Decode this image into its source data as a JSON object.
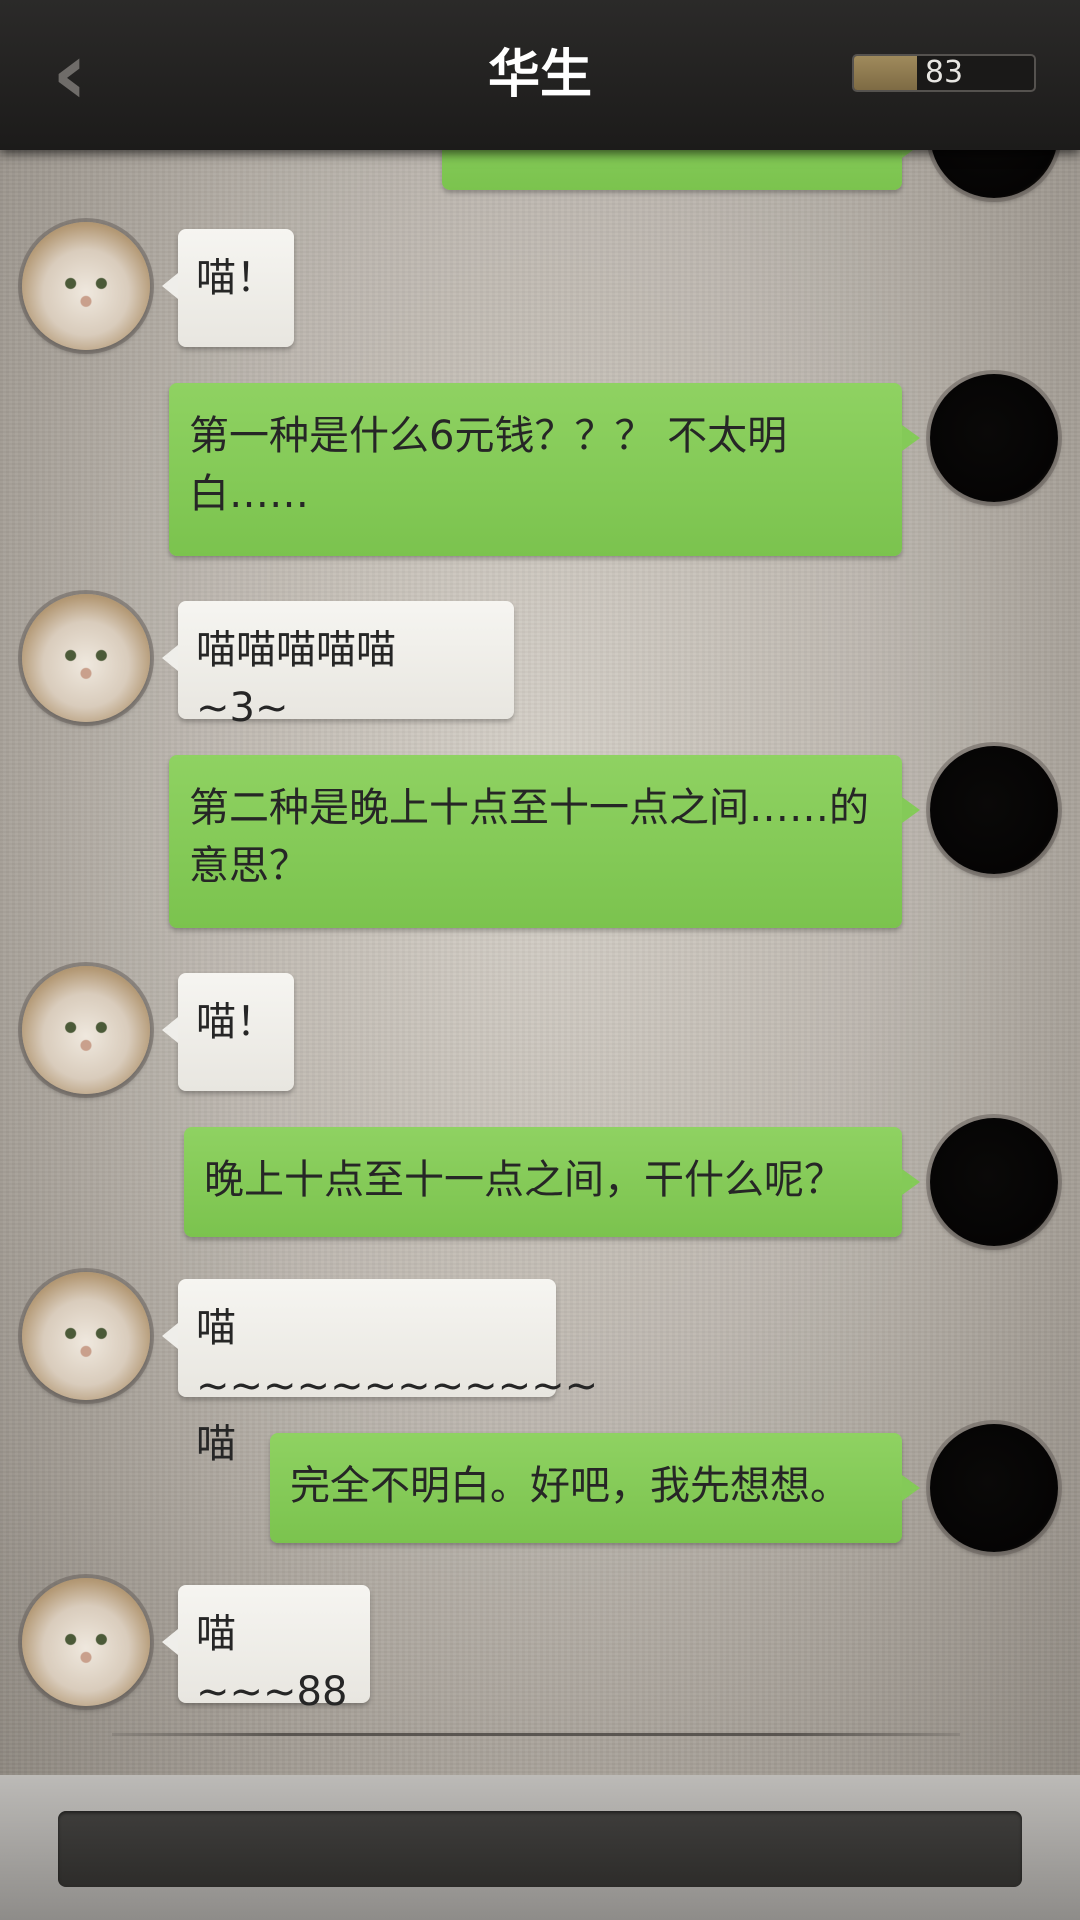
{
  "header": {
    "back_icon": "chevron-left-icon",
    "title": "华生",
    "score_value": 83,
    "score_label": "83",
    "score_fill_fraction": 0.35
  },
  "messages": [
    {
      "side": "out",
      "text": ""
    },
    {
      "side": "in",
      "text": "喵！"
    },
    {
      "side": "out",
      "text": "第一种是什么6元钱？？？ 不太明白……"
    },
    {
      "side": "in",
      "text": "喵喵喵喵喵 ~3~"
    },
    {
      "side": "out",
      "text": "第二种是晚上十点至十一点之间……的意思？"
    },
    {
      "side": "in",
      "text": "喵！"
    },
    {
      "side": "out",
      "text": "晚上十点至十一点之间，干什么呢？"
    },
    {
      "side": "in",
      "text": "喵~~~~~~~~~~~~喵"
    },
    {
      "side": "out",
      "text": "完全不明白。好吧，我先想想。"
    },
    {
      "side": "in",
      "text": "喵~~~88"
    }
  ],
  "input": {
    "placeholder": ""
  },
  "colors": {
    "header_bg": "#1f1e1d",
    "outgoing_bubble": "#84ca58",
    "incoming_bubble": "#efeeea",
    "score_fill": "#8f7a50"
  }
}
